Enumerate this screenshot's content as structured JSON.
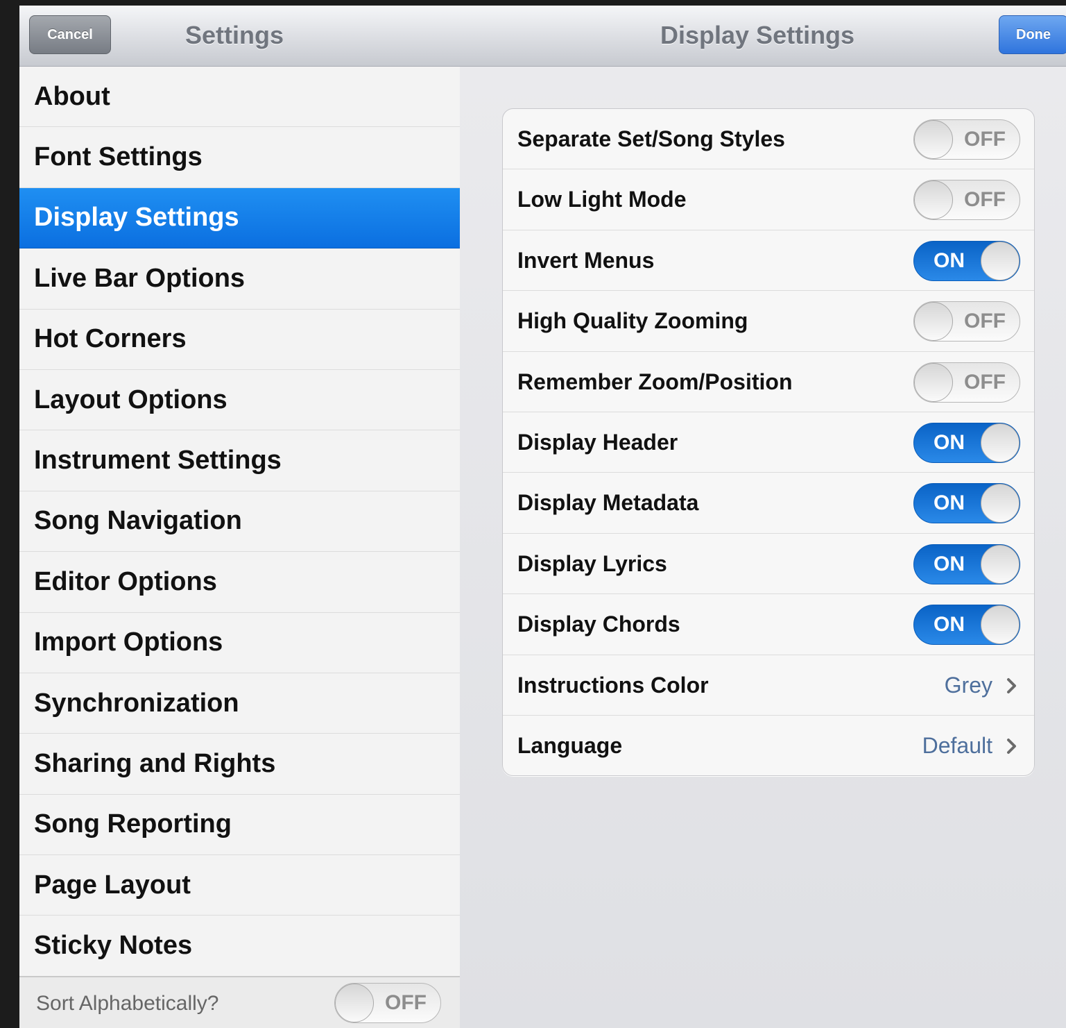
{
  "navbar": {
    "cancel_label": "Cancel",
    "master_title": "Settings",
    "detail_title": "Display Settings",
    "done_label": "Done"
  },
  "master": {
    "items": [
      {
        "label": "About",
        "selected": false
      },
      {
        "label": "Font Settings",
        "selected": false
      },
      {
        "label": "Display Settings",
        "selected": true
      },
      {
        "label": "Live Bar Options",
        "selected": false
      },
      {
        "label": "Hot Corners",
        "selected": false
      },
      {
        "label": "Layout Options",
        "selected": false
      },
      {
        "label": "Instrument Settings",
        "selected": false
      },
      {
        "label": "Song Navigation",
        "selected": false
      },
      {
        "label": "Editor Options",
        "selected": false
      },
      {
        "label": "Import Options",
        "selected": false
      },
      {
        "label": "Synchronization",
        "selected": false
      },
      {
        "label": "Sharing and Rights",
        "selected": false
      },
      {
        "label": "Song Reporting",
        "selected": false
      },
      {
        "label": "Page Layout",
        "selected": false
      },
      {
        "label": "Sticky Notes",
        "selected": false
      }
    ],
    "sort": {
      "label": "Sort Alphabetically?",
      "state": "OFF"
    }
  },
  "detail": {
    "rows": [
      {
        "label": "Separate Set/Song Styles",
        "type": "switch",
        "state": "OFF"
      },
      {
        "label": "Low Light Mode",
        "type": "switch",
        "state": "OFF"
      },
      {
        "label": "Invert Menus",
        "type": "switch",
        "state": "ON"
      },
      {
        "label": "High Quality Zooming",
        "type": "switch",
        "state": "OFF"
      },
      {
        "label": "Remember Zoom/Position",
        "type": "switch",
        "state": "OFF"
      },
      {
        "label": "Display Header",
        "type": "switch",
        "state": "ON"
      },
      {
        "label": "Display Metadata",
        "type": "switch",
        "state": "ON"
      },
      {
        "label": "Display Lyrics",
        "type": "switch",
        "state": "ON"
      },
      {
        "label": "Display Chords",
        "type": "switch",
        "state": "ON"
      },
      {
        "label": "Instructions Color",
        "type": "disclosure",
        "value": "Grey"
      },
      {
        "label": "Language",
        "type": "disclosure",
        "value": "Default"
      }
    ]
  },
  "colors": {
    "selection": "#1480ea",
    "switch_on": "#1a78dc",
    "value_text": "#4e6f9c",
    "done_button": "#3a7fe3"
  },
  "icons": {
    "disclosure": "chevron-right-icon"
  }
}
